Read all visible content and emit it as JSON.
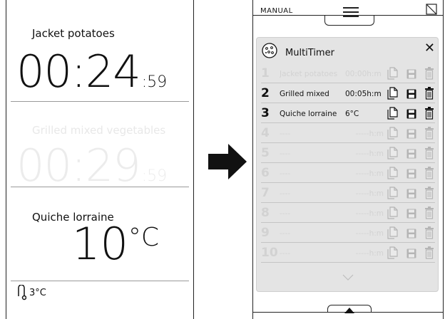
{
  "left_screen": {
    "timers": [
      {
        "name": "Jacket potatoes",
        "time": "00:24",
        "seconds": ":59",
        "active": true
      },
      {
        "name": "Grilled mixed vegetables",
        "time": "00:29",
        "seconds": ":59",
        "active": false
      }
    ],
    "probe": {
      "name": "Quiche lorraine",
      "temperature": "10",
      "unit": "°C"
    },
    "probe_status": {
      "icon": "thermometer-probe-icon",
      "value": "3°C"
    }
  },
  "arrow": {
    "icon": "arrow-right-icon"
  },
  "right_screen": {
    "mode": "MANUAL",
    "menu_icon": "hamburger-icon",
    "connectivity_icon": "no-signal-icon",
    "dialog": {
      "title": "MultiTimer",
      "title_icon": "cookie-icon",
      "close_label": "✕",
      "rows": [
        {
          "num": "1",
          "name": "Jacket potatoes",
          "value": "00:00h:m",
          "active": false
        },
        {
          "num": "2",
          "name": "Grilled mixed",
          "value": "00:05h:m",
          "active": true
        },
        {
          "num": "3",
          "name": "Quiche lorraine",
          "value": "6°C",
          "active": true
        },
        {
          "num": "4",
          "name": "----",
          "value": "-----h:m",
          "active": false
        },
        {
          "num": "5",
          "name": "----",
          "value": "-----h:m",
          "active": false
        },
        {
          "num": "6",
          "name": "----",
          "value": "-----h:m",
          "active": false
        },
        {
          "num": "7",
          "name": "----",
          "value": "-----h:m",
          "active": false
        },
        {
          "num": "8",
          "name": "----",
          "value": "-----h:m",
          "active": false
        },
        {
          "num": "9",
          "name": "----",
          "value": "-----h:m",
          "active": false
        },
        {
          "num": "10",
          "name": "----",
          "value": "-----h:m",
          "active": false
        }
      ],
      "scroll_icon": "chevron-down-icon"
    },
    "bottom_icon": "chevron-up-icon"
  }
}
